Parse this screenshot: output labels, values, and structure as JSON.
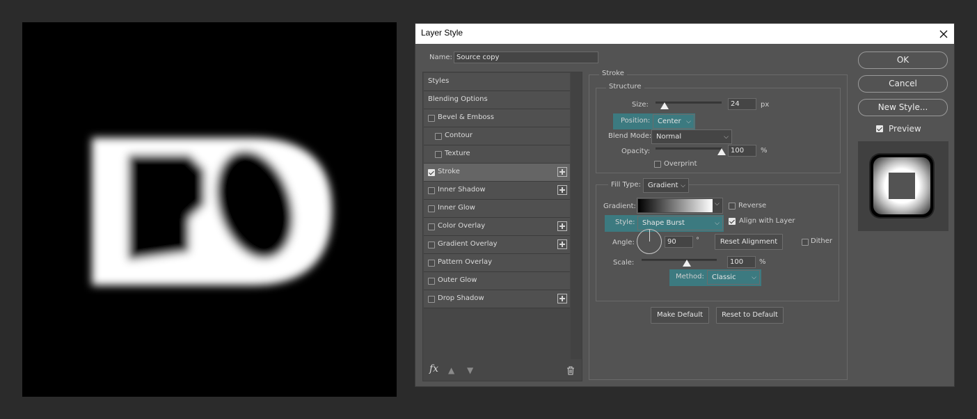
{
  "dialog": {
    "title": "Layer Style",
    "name_label": "Name:",
    "name_value": "Source copy"
  },
  "styles_list": [
    {
      "label": "Styles",
      "checkbox": false,
      "plus": false,
      "indent": 0,
      "selected": false
    },
    {
      "label": "Blending Options",
      "checkbox": false,
      "plus": false,
      "indent": 0,
      "selected": false
    },
    {
      "label": "Bevel & Emboss",
      "checkbox": true,
      "checked": false,
      "plus": false,
      "indent": 0
    },
    {
      "label": "Contour",
      "checkbox": true,
      "checked": false,
      "plus": false,
      "indent": 1
    },
    {
      "label": "Texture",
      "checkbox": true,
      "checked": false,
      "plus": false,
      "indent": 1
    },
    {
      "label": "Stroke",
      "checkbox": true,
      "checked": true,
      "plus": true,
      "indent": 0,
      "selected": true
    },
    {
      "label": "Inner Shadow",
      "checkbox": true,
      "checked": false,
      "plus": true,
      "indent": 0
    },
    {
      "label": "Inner Glow",
      "checkbox": true,
      "checked": false,
      "plus": false,
      "indent": 0
    },
    {
      "label": "Color Overlay",
      "checkbox": true,
      "checked": false,
      "plus": true,
      "indent": 0
    },
    {
      "label": "Gradient Overlay",
      "checkbox": true,
      "checked": false,
      "plus": true,
      "indent": 0
    },
    {
      "label": "Pattern Overlay",
      "checkbox": true,
      "checked": false,
      "plus": false,
      "indent": 0
    },
    {
      "label": "Outer Glow",
      "checkbox": true,
      "checked": false,
      "plus": false,
      "indent": 0
    },
    {
      "label": "Drop Shadow",
      "checkbox": true,
      "checked": false,
      "plus": true,
      "indent": 0
    }
  ],
  "list_footer": {
    "fx": "fx"
  },
  "stroke": {
    "section_title": "Stroke",
    "structure_title": "Structure",
    "size_label": "Size:",
    "size_value": "24",
    "size_unit": "px",
    "position_label": "Position:",
    "position_value": "Center",
    "blend_mode_label": "Blend Mode:",
    "blend_mode_value": "Normal",
    "opacity_label": "Opacity:",
    "opacity_value": "100",
    "opacity_unit": "%",
    "overprint_label": "Overprint",
    "fill_type_label": "Fill Type:",
    "fill_type_value": "Gradient",
    "gradient_label": "Gradient:",
    "reverse_label": "Reverse",
    "style_label": "Style:",
    "style_value": "Shape Burst",
    "align_label": "Align with Layer",
    "angle_label": "Angle:",
    "angle_value": "90",
    "angle_unit": "°",
    "reset_alignment_label": "Reset Alignment",
    "dither_label": "Dither",
    "scale_label": "Scale:",
    "scale_value": "100",
    "scale_unit": "%",
    "method_label": "Method:",
    "method_value": "Classic",
    "make_default_label": "Make Default",
    "reset_default_label": "Reset to Default"
  },
  "buttons": {
    "ok": "OK",
    "cancel": "Cancel",
    "new_style": "New Style...",
    "preview_label": "Preview"
  },
  "colors": {
    "highlight": "#3c7a80",
    "dialog_bg": "#535353",
    "canvas_bg": "#000000"
  }
}
